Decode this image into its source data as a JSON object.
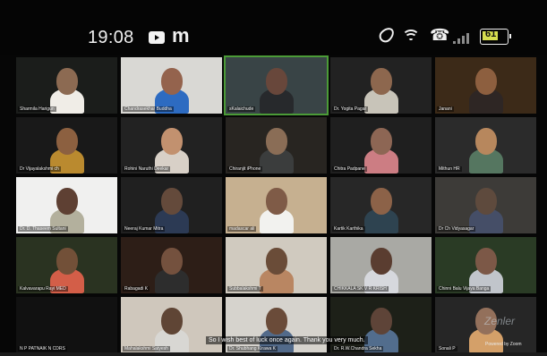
{
  "status_bar": {
    "time": "19:08",
    "app_icons": [
      "play-icon",
      "m-icon"
    ],
    "system_icons": [
      "water-drop-icon",
      "wifi-icon",
      "call-icon",
      "signal-icon",
      "battery-icon"
    ],
    "battery": "61"
  },
  "meeting": {
    "active_speaker": "sKalaichude",
    "caption": "So I wish best of luck once again. Thank you very much.",
    "powered_by": "Powered by Zoom",
    "watermark": "Zenler"
  },
  "participants": [
    {
      "name": "Sharmila Harigun",
      "bg": "#1b1d1b",
      "face": "#8c6a52",
      "shirt": "#f0ede7"
    },
    {
      "name": "Chandrasekhar Buddha",
      "bg": "#d9d8d4",
      "face": "#94634d",
      "shirt": "#2d6bc1"
    },
    {
      "name": "sKalaichude",
      "bg": "#394446",
      "face": "#68473b",
      "shirt": "#27292c",
      "active": true
    },
    {
      "name": "Dr. Yogita Pagar",
      "bg": "#222",
      "face": "#8d674e",
      "shirt": "#c8c4b9"
    },
    {
      "name": "Janani",
      "bg": "#3c2a18",
      "face": "#8d5f3f",
      "shirt": "#2e2624"
    },
    {
      "name": "Dr Vijayalakshmi ch",
      "bg": "#191919",
      "face": "#8c6040",
      "shirt": "#ba8a2f"
    },
    {
      "name": "Rohini Naruthi Deekar",
      "bg": "#222",
      "face": "#c2916f",
      "shirt": "#d8d0c7"
    },
    {
      "name": "Chiranjit iPhone",
      "bg": "#282521",
      "face": "#8a6d56",
      "shirt": "#3b3d3d"
    },
    {
      "name": "Chitra Padpane",
      "bg": "#1f1f1f",
      "face": "#8d6654",
      "shirt": "#cc7d83"
    },
    {
      "name": "Mithun HR",
      "bg": "#2b2b2b",
      "face": "#b7875d",
      "shirt": "#557660"
    },
    {
      "name": "Dr. D. Thaseem Sultani",
      "bg": "#f0f0ef",
      "face": "#5e4033",
      "shirt": "#b3b09d"
    },
    {
      "name": "Neeraj Kumar Mitra",
      "bg": "#202020",
      "face": "#644a3b",
      "shirt": "#2c3a54"
    },
    {
      "name": "madascar ali",
      "bg": "#c6b090",
      "face": "#7f5b47",
      "shirt": "#f2f2ef"
    },
    {
      "name": "Kartik Karthika",
      "bg": "#272727",
      "face": "#8c6248",
      "shirt": "#2e4350"
    },
    {
      "name": "Dr Ch Vidyasagar",
      "bg": "#3d3b38",
      "face": "#5e4a3d",
      "shirt": "#454e67"
    },
    {
      "name": "Kalvavarapu Rayi MED",
      "bg": "#2a3321",
      "face": "#725038",
      "shirt": "#d35e48"
    },
    {
      "name": "Rabagadi K",
      "bg": "#2d1e17",
      "face": "#74513e",
      "shirt": "#2d2d2d"
    },
    {
      "name": "Subbalakshmi T",
      "bg": "#d0cabf",
      "face": "#6a4c38",
      "shirt": "#b98662"
    },
    {
      "name": "CHIKKALA SK V R KRISH",
      "bg": "#a9a9a4",
      "face": "#5a3d30",
      "shirt": "#d6d8dd"
    },
    {
      "name": "Chinni Balu Vijaya Banga",
      "bg": "#2a3b25",
      "face": "#7c5847",
      "shirt": "#c1c5cb"
    },
    {
      "name": "N P PATNAIK N CDRS",
      "bg": "#111111",
      "face": "#000000",
      "shirt": "#000000",
      "empty": true
    },
    {
      "name": "Mahalakshmi Satyesh",
      "bg": "#cfc7bc",
      "face": "#5f4535",
      "shirt": "#d8d7d3"
    },
    {
      "name": "Dr. Shubhang Kirawa K",
      "bg": "#d6d3cd",
      "face": "#6a4b39",
      "shirt": "#526a8a"
    },
    {
      "name": "Dr. R.W.Chandra Sekha",
      "bg": "#1d2018",
      "face": "#5e4438",
      "shirt": "#526d8d"
    },
    {
      "name": "Sonali P",
      "bg": "#262626",
      "face": "#93705b",
      "shirt": "#d4a069"
    }
  ]
}
